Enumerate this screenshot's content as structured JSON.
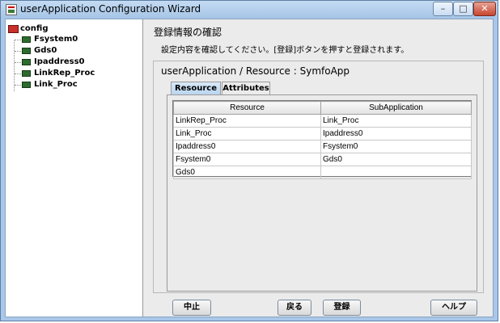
{
  "window": {
    "title": "userApplication Configuration Wizard",
    "controls": {
      "minimize": "–",
      "maximize": "□",
      "close": "✕"
    }
  },
  "tree": {
    "root": "config",
    "items": [
      {
        "label": "Fsystem0"
      },
      {
        "label": "Gds0"
      },
      {
        "label": "Ipaddress0"
      },
      {
        "label": "LinkRep_Proc"
      },
      {
        "label": "Link_Proc"
      }
    ]
  },
  "main": {
    "heading": "登録情報の確認",
    "instruction": "設定内容を確認してください。[登録]ボタンを押すと登録されます。",
    "resource_title": "userApplication / Resource  :  SymfoApp",
    "tabs": [
      {
        "label": "Resource",
        "active": true
      },
      {
        "label": "Attributes",
        "active": false
      }
    ],
    "table": {
      "headers": [
        "Resource",
        "SubApplication"
      ],
      "rows": [
        [
          "LinkRep_Proc",
          "Link_Proc"
        ],
        [
          "Link_Proc",
          "Ipaddress0"
        ],
        [
          "Ipaddress0",
          "Fsystem0"
        ],
        [
          "Fsystem0",
          "Gds0"
        ],
        [
          "Gds0",
          ""
        ]
      ]
    }
  },
  "buttons": {
    "cancel": "中止",
    "back": "戻る",
    "register": "登録",
    "help": "ヘルプ"
  },
  "colors": {
    "titlebar": "#b3cfee",
    "tab_active": "#c8ddf4",
    "root_icon": "#c8302a",
    "node_icon": "#2e6b2e"
  }
}
